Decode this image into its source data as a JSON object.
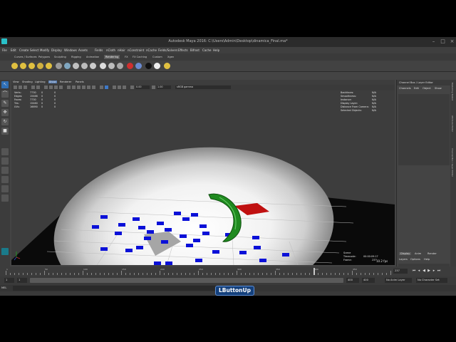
{
  "window": {
    "title": "Autodesk Maya 2016: C:\\Users\\Admin\\Desktop\\dinamica_Final.ma*"
  },
  "menus": [
    "File",
    "Edit",
    "Create",
    "Select",
    "Modify",
    "Display",
    "Windows",
    "Assets",
    "Fields",
    "nCloth",
    "nHair",
    "nConstraint",
    "nCache",
    "Fields/Solvers",
    "Effects",
    "Bifrost",
    "Cache",
    "Help"
  ],
  "shelf_tabs": [
    "Curves / Surfaces",
    "Polygons",
    "Sculpting",
    "Rigging",
    "Animation",
    "Rendering",
    "FX",
    "FX Caching",
    "Custom",
    "Xgen"
  ],
  "shelf_active": "Rendering",
  "panel_menus": [
    "View",
    "Shading",
    "Lighting",
    "Show",
    "Renderer",
    "Panels"
  ],
  "panel_fields": {
    "near": "0.00",
    "far": "1.00",
    "colorspace": "sRGB gamma"
  },
  "hud_left": {
    "rows": [
      {
        "label": "Verts:",
        "v1": "7730",
        "v2": "0",
        "v3": "0"
      },
      {
        "label": "Edges:",
        "v1": "15466",
        "v2": "0",
        "v3": "0"
      },
      {
        "label": "Faces:",
        "v1": "7730",
        "v2": "0",
        "v3": "0"
      },
      {
        "label": "Tris:",
        "v1": "15460",
        "v2": "0",
        "v3": "0"
      },
      {
        "label": "UVs:",
        "v1": "16690",
        "v2": "0",
        "v3": "0"
      }
    ]
  },
  "hud_right": {
    "rows": [
      {
        "label": "Backfaces:",
        "value": "N/A"
      },
      {
        "label": "Smoothness:",
        "value": "N/A"
      },
      {
        "label": "Instance:",
        "value": "N/A"
      },
      {
        "label": "Display Layer:",
        "value": "N/A"
      },
      {
        "label": "Distance From Camera:",
        "value": "N/A"
      },
      {
        "label": "Selected Objects:",
        "value": "N/A"
      }
    ]
  },
  "hud_bottom": {
    "timecode_label": "Scene Timecode:",
    "timecode_value": "00:00:09:17",
    "frame_label": "Frame:",
    "frame_value": "237",
    "fps": "10.2 fps"
  },
  "channel_box": {
    "title": "Channel Box / Layer Editor",
    "tabs": [
      "Channels",
      "Edit",
      "Object",
      "Show"
    ],
    "layer_tabs": [
      "Display",
      "Anim",
      "Render"
    ],
    "layer_menus": [
      "Layers",
      "Options",
      "Help"
    ]
  },
  "right_strip": [
    "Modelling Toolkit",
    "Attribute Editor",
    "Channel Box / Layer Editor"
  ],
  "time_slider": {
    "current_frame": "237",
    "playhead_fraction": 0.8,
    "tick_labels": [
      "1",
      "50",
      "100",
      "150",
      "200",
      "250",
      "300",
      "350",
      "400",
      "450"
    ]
  },
  "range_slider": {
    "start": "1",
    "inner_start": "1",
    "inner_end": "400",
    "end": "400",
    "anim_layer": "No Anim Layer",
    "char_set": "No Character Set"
  },
  "command_line": {
    "label": "MEL"
  },
  "overlay": {
    "mouse_event": "LButtonUp"
  },
  "colors": {
    "accent": "#29c0c8",
    "ground_spot": "#ffffff",
    "cubes": "#0a10d8",
    "coil": "#1f8a1f",
    "red_plane": "#c01010",
    "grey_box": "#a0a0a0"
  }
}
